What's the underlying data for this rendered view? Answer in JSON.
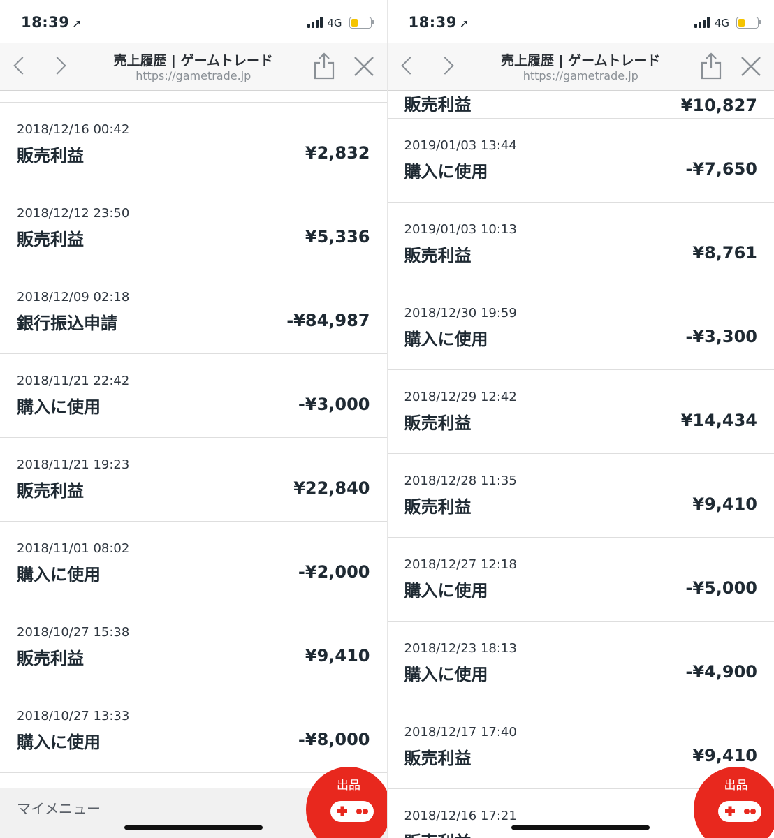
{
  "status": {
    "time": "18:39",
    "network": "4G"
  },
  "browser": {
    "title": "売上履歴 | ゲームトレード",
    "url": "https://gametrade.jp"
  },
  "left": {
    "rows": [
      {
        "date": "2018/12/16 00:42",
        "label": "販売利益",
        "amount": "¥2,832"
      },
      {
        "date": "2018/12/12 23:50",
        "label": "販売利益",
        "amount": "¥5,336"
      },
      {
        "date": "2018/12/09 02:18",
        "label": "銀行振込申請",
        "amount": "-¥84,987"
      },
      {
        "date": "2018/11/21 22:42",
        "label": "購入に使用",
        "amount": "-¥3,000"
      },
      {
        "date": "2018/11/21 19:23",
        "label": "販売利益",
        "amount": "¥22,840"
      },
      {
        "date": "2018/11/01 08:02",
        "label": "購入に使用",
        "amount": "-¥2,000"
      },
      {
        "date": "2018/10/27 15:38",
        "label": "販売利益",
        "amount": "¥9,410"
      },
      {
        "date": "2018/10/27 13:33",
        "label": "購入に使用",
        "amount": "-¥8,000"
      }
    ],
    "mymenu": "マイメニュー"
  },
  "right": {
    "partial_top": {
      "label": "販売利益",
      "amount": "¥10,827"
    },
    "rows": [
      {
        "date": "2019/01/03 13:44",
        "label": "購入に使用",
        "amount": "-¥7,650"
      },
      {
        "date": "2019/01/03 10:13",
        "label": "販売利益",
        "amount": "¥8,761"
      },
      {
        "date": "2018/12/30 19:59",
        "label": "購入に使用",
        "amount": "-¥3,300"
      },
      {
        "date": "2018/12/29 12:42",
        "label": "販売利益",
        "amount": "¥14,434"
      },
      {
        "date": "2018/12/28 11:35",
        "label": "販売利益",
        "amount": "¥9,410"
      },
      {
        "date": "2018/12/27 12:18",
        "label": "購入に使用",
        "amount": "-¥5,000"
      },
      {
        "date": "2018/12/23 18:13",
        "label": "購入に使用",
        "amount": "-¥4,900"
      },
      {
        "date": "2018/12/17 17:40",
        "label": "販売利益",
        "amount": "¥9,410"
      },
      {
        "date": "2018/12/16 17:21",
        "label": "販売利益",
        "amount": ""
      }
    ]
  },
  "fab": {
    "label": "出品",
    "icon": "gamepad-icon",
    "color": "#e8281e"
  },
  "battery": {
    "level": 0.35,
    "color": "#f5c400"
  }
}
